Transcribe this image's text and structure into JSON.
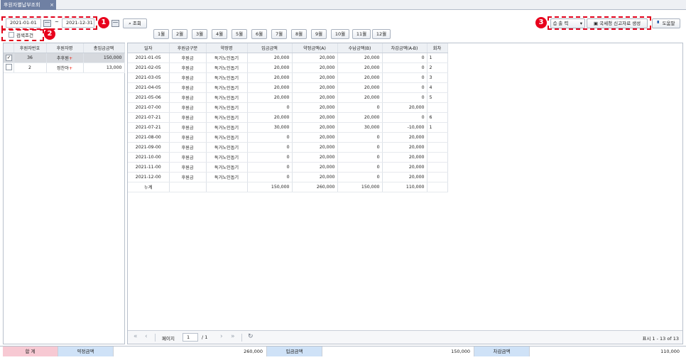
{
  "tab": {
    "title": "후원자별납부조회",
    "close": "×"
  },
  "filter": {
    "date_from": "2021-01-01",
    "date_sep": "~",
    "date_to": "2021-12-31",
    "search_label": "조회",
    "months": [
      "1월",
      "2월",
      "3월",
      "4월",
      "5월",
      "6월",
      "7월",
      "8월",
      "9월",
      "10월",
      "11월",
      "12월"
    ],
    "search_condition_label": "검색조건"
  },
  "actions": {
    "print_label": "출 력",
    "tax_report_label": "국세청 신고자료 생성",
    "help_label": "도움말"
  },
  "badges": [
    "1",
    "2",
    "3"
  ],
  "left_table": {
    "headers": [
      "후원자번호",
      "후원자명",
      "총입금금액"
    ],
    "rows": [
      {
        "checked": true,
        "no": "36",
        "name": "추후원",
        "total": "150,000"
      },
      {
        "checked": false,
        "no": "2",
        "name": "정찬아",
        "total": "13,000"
      }
    ]
  },
  "detail_table": {
    "headers": [
      "일자",
      "후원금구분",
      "약정명",
      "입금금액",
      "약정금액(A)",
      "수납금액(B)",
      "차감금액(A-B)",
      "회차"
    ],
    "rows": [
      [
        "2021-01-05",
        "후원금",
        "독거노인돕기",
        "20,000",
        "20,000",
        "20,000",
        "0",
        "1"
      ],
      [
        "2021-02-05",
        "후원금",
        "독거노인돕기",
        "20,000",
        "20,000",
        "20,000",
        "0",
        "2"
      ],
      [
        "2021-03-05",
        "후원금",
        "독거노인돕기",
        "20,000",
        "20,000",
        "20,000",
        "0",
        "3"
      ],
      [
        "2021-04-05",
        "후원금",
        "독거노인돕기",
        "20,000",
        "20,000",
        "20,000",
        "0",
        "4"
      ],
      [
        "2021-05-06",
        "후원금",
        "독거노인돕기",
        "20,000",
        "20,000",
        "20,000",
        "0",
        "5"
      ],
      [
        "2021-07-00",
        "후원금",
        "독거노인돕기",
        "0",
        "20,000",
        "0",
        "20,000",
        ""
      ],
      [
        "2021-07-21",
        "후원금",
        "독거노인돕기",
        "20,000",
        "20,000",
        "20,000",
        "0",
        "6"
      ],
      [
        "2021-07-21",
        "후원금",
        "독거노인돕기",
        "30,000",
        "20,000",
        "30,000",
        "-10,000",
        "1"
      ],
      [
        "2021-08-00",
        "후원금",
        "독거노인돕기",
        "0",
        "20,000",
        "0",
        "20,000",
        ""
      ],
      [
        "2021-09-00",
        "후원금",
        "독거노인돕기",
        "0",
        "20,000",
        "0",
        "20,000",
        ""
      ],
      [
        "2021-10-00",
        "후원금",
        "독거노인돕기",
        "0",
        "20,000",
        "0",
        "20,000",
        ""
      ],
      [
        "2021-11-00",
        "후원금",
        "독거노인돕기",
        "0",
        "20,000",
        "0",
        "20,000",
        ""
      ],
      [
        "2021-12-00",
        "후원금",
        "독거노인돕기",
        "0",
        "20,000",
        "0",
        "20,000",
        ""
      ]
    ],
    "total_row": [
      "누계",
      "",
      "",
      "150,000",
      "260,000",
      "150,000",
      "110,000",
      ""
    ]
  },
  "pager": {
    "page_label": "페이지",
    "page_value": "1",
    "page_of": "/ 1",
    "summary": "표시 1 - 13 of 13"
  },
  "totals": {
    "label": "합 계",
    "pledge_label": "약정금액",
    "pledge_value": "260,000",
    "deposit_label": "입금금액",
    "deposit_value": "150,000",
    "diff_label": "차감금액",
    "diff_value": "110,000"
  }
}
